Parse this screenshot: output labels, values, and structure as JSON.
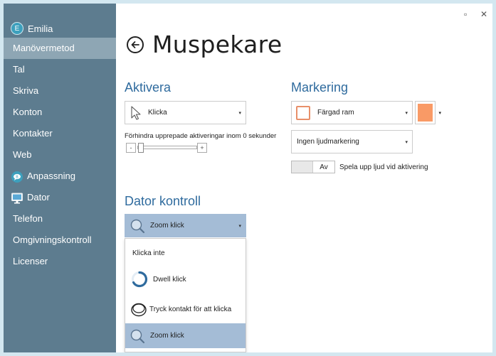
{
  "window": {
    "minimize_glyph": "▫",
    "close_glyph": "✕"
  },
  "user": {
    "initial": "E",
    "name": "Emilia"
  },
  "sidebar": {
    "items": [
      {
        "label": "Manövermetod",
        "active": true,
        "icon": ""
      },
      {
        "label": "Tal",
        "active": false,
        "icon": ""
      },
      {
        "label": "Skriva",
        "active": false,
        "icon": ""
      },
      {
        "label": "Konton",
        "active": false,
        "icon": ""
      },
      {
        "label": "Kontakter",
        "active": false,
        "icon": ""
      },
      {
        "label": "Web",
        "active": false,
        "icon": ""
      },
      {
        "label": "Anpassning",
        "active": false,
        "icon": "chat-bubble-icon"
      },
      {
        "label": "Dator",
        "active": false,
        "icon": "monitor-icon"
      },
      {
        "label": "Telefon",
        "active": false,
        "icon": ""
      },
      {
        "label": "Omgivningskontroll",
        "active": false,
        "icon": ""
      },
      {
        "label": "Licenser",
        "active": false,
        "icon": ""
      }
    ]
  },
  "page": {
    "title": "Muspekare"
  },
  "aktivera": {
    "title": "Aktivera",
    "select_value": "Klicka",
    "repeat_label": "Förhindra upprepade aktiveringar inom 0 sekunder",
    "minus": "-",
    "plus": "+",
    "slider_value": 0
  },
  "markering": {
    "title": "Markering",
    "style_value": "Färgad ram",
    "color": "#f99a66",
    "sound_value": "Ingen ljudmarkering",
    "toggle_state": "Av",
    "toggle_caption": "Spela upp ljud vid aktivering"
  },
  "dator_kontroll": {
    "title": "Dator kontroll",
    "select_value": "Zoom klick",
    "options": [
      {
        "label": "Klicka inte",
        "icon": ""
      },
      {
        "label": "Dwell klick",
        "icon": "dwell-ring-icon"
      },
      {
        "label": "Tryck kontakt för att klicka",
        "icon": "switch-button-icon"
      },
      {
        "label": "Zoom klick",
        "icon": "magnifier-icon",
        "selected": true
      }
    ]
  },
  "colors": {
    "sidebar_bg": "#5d7c8f",
    "sidebar_active": "#8ea6b4",
    "accent_blue": "#2f6b9e",
    "selected_item": "#a4bcd6",
    "frame_border": "#d3e7f0"
  }
}
